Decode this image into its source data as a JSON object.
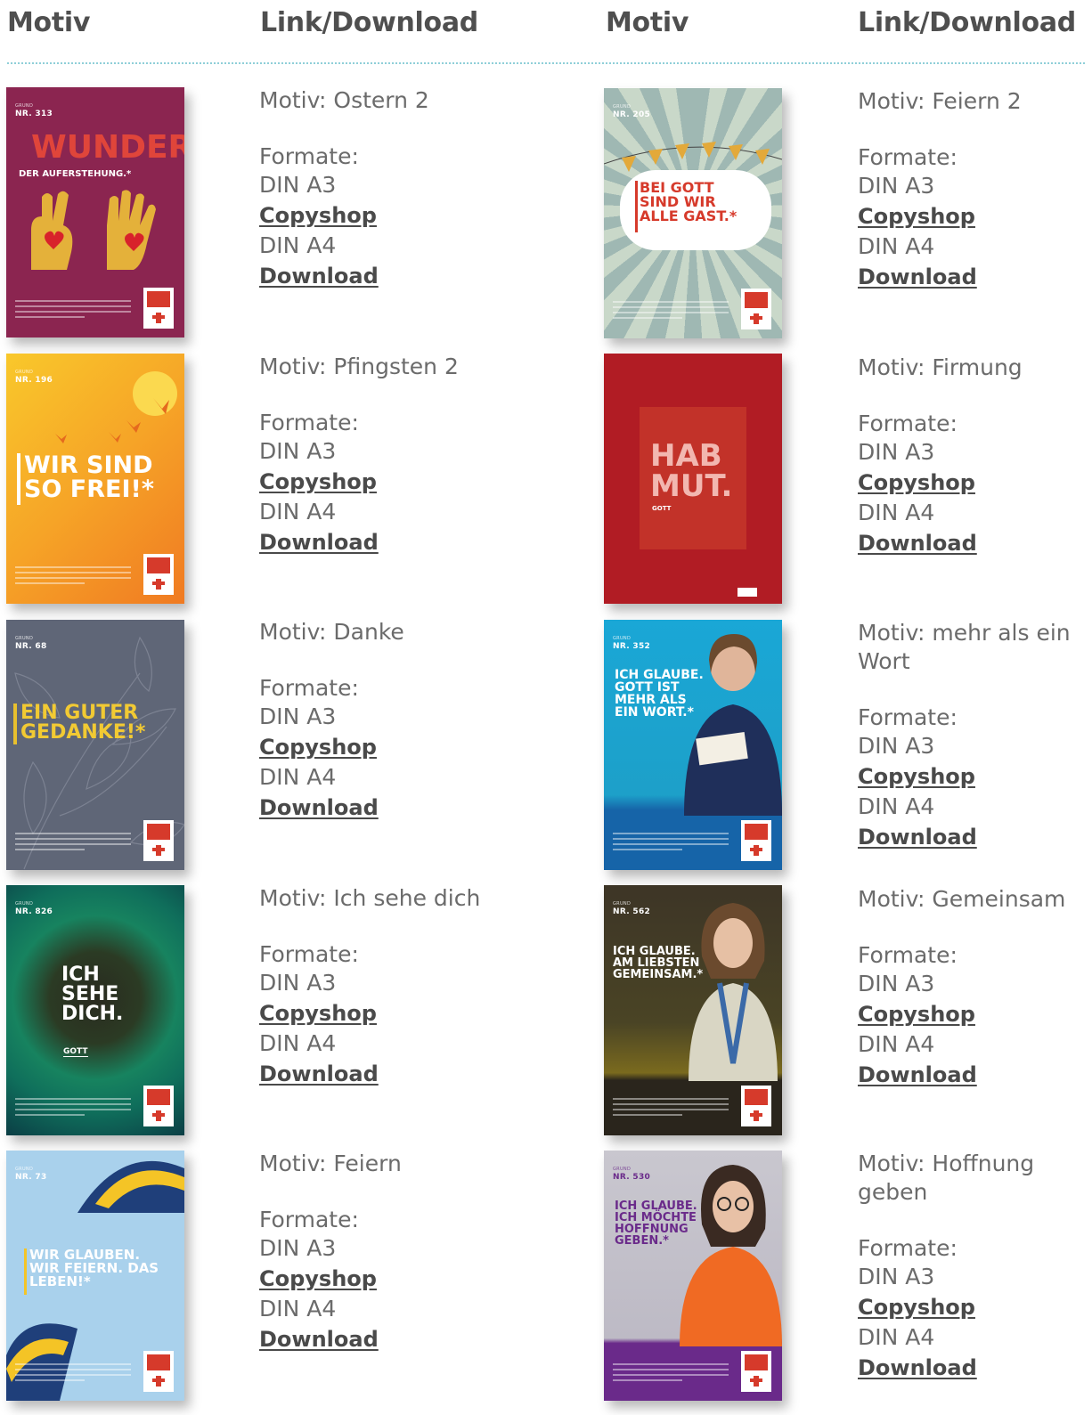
{
  "headers": {
    "left_motiv": "Motiv",
    "left_link": "Link/Download",
    "right_motiv": "Motiv",
    "right_link": "Link/Download"
  },
  "labels": {
    "formats": "Formate:",
    "a3": "DIN A3",
    "a4": "DIN A4",
    "copyshop": "Copyshop",
    "download": "Download"
  },
  "left_column": [
    {
      "title": "Motiv: Ostern 2",
      "poster": {
        "nr": "NR. 313",
        "headline": "WUNDER",
        "sub": "DER AUFERSTEHUNG.*"
      }
    },
    {
      "title": "Motiv: Pfingsten 2",
      "poster": {
        "nr": "NR. 196",
        "headline": "WIR SIND SO FREI!*"
      }
    },
    {
      "title": "Motiv: Danke",
      "poster": {
        "nr": "NR. 68",
        "headline": "EIN GUTER GEDANKE!*"
      }
    },
    {
      "title": "Motiv: Ich sehe dich",
      "poster": {
        "nr": "NR. 826",
        "headline": "ICH SEHE DICH.",
        "sub": "GOTT"
      }
    },
    {
      "title": "Motiv: Feiern",
      "poster": {
        "nr": "NR. 73",
        "headline": "WIR GLAUBEN. WIR FEIERN. DAS LEBEN!*"
      }
    }
  ],
  "right_column": [
    {
      "title": "Motiv: Feiern 2",
      "poster": {
        "nr": "NR. 205",
        "headline": "BEI GOTT SIND WIR ALLE GAST.*"
      }
    },
    {
      "title": "Motiv: Firmung",
      "poster": {
        "nr": "",
        "headline": "HAB MUT.",
        "sub": "GOTT"
      }
    },
    {
      "title": "Motiv: mehr als ein Wort",
      "poster": {
        "nr": "NR. 352",
        "headline": "ICH GLAUBE. GOTT IST MEHR ALS EIN WORT.*"
      }
    },
    {
      "title": "Motiv: Gemeinsam",
      "poster": {
        "nr": "NR. 562",
        "headline": "ICH GLAUBE. AM LIEBSTEN GEMEINSAM.*"
      }
    },
    {
      "title": "Motiv: Hoffnung geben",
      "poster": {
        "nr": "NR. 530",
        "headline": "ICH GLAUBE. ICH MÖCHTE HOFFNUNG GEBEN.*"
      }
    }
  ],
  "colors": {
    "header_text": "#4f4f4f",
    "body_text": "#6b6b6b",
    "link_text": "#4a4a4a",
    "divider": "#8fcfd8"
  }
}
